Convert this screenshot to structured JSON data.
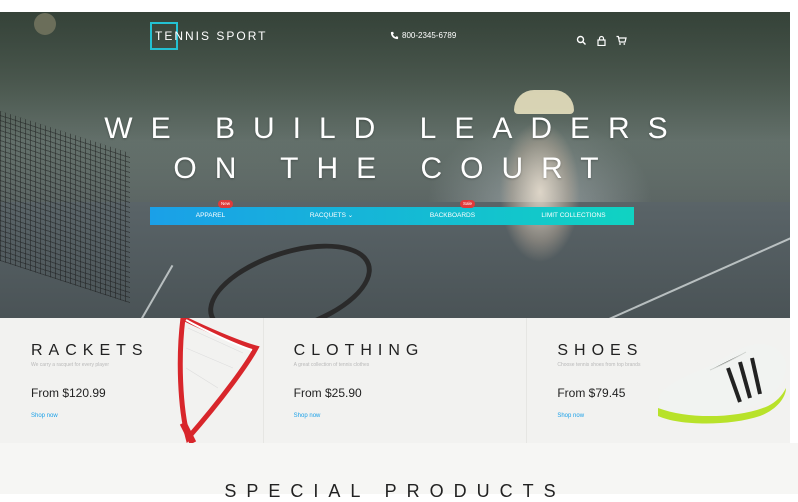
{
  "header": {
    "logo_highlight": "TE",
    "logo_rest": "NNIS SPORT",
    "phone": "800-2345-6789",
    "icons": [
      "search-icon",
      "lock-icon",
      "cart-icon"
    ],
    "accent_color": "#23c1d3"
  },
  "hero": {
    "headline_line1": "WE BUILD LEADERS",
    "headline_line2": "ON THE COURT"
  },
  "nav": {
    "items": [
      {
        "label": "APPAREL",
        "badge": "New"
      },
      {
        "label": "RACQUETS ⌄",
        "badge": ""
      },
      {
        "label": "BACKBOARDS",
        "badge": "Sale"
      },
      {
        "label": "LIMIT COLLECTIONS",
        "badge": ""
      }
    ],
    "gradient": [
      "#1aa0e8",
      "#10d3c2"
    ]
  },
  "categories": [
    {
      "title": "RACKETS",
      "subtitle": "We carry a racquet for every player",
      "price": "From $120.99",
      "link": "Shop now"
    },
    {
      "title": "CLOTHING",
      "subtitle": "A great collection of tennis clothes",
      "price": "From $25.90",
      "link": "Shop now"
    },
    {
      "title": "SHOES",
      "subtitle": "Choose tennis shoes from top brands",
      "price": "From $79.45",
      "link": "Shop now"
    }
  ],
  "special": {
    "title": "SPECIAL PRODUCTS"
  }
}
